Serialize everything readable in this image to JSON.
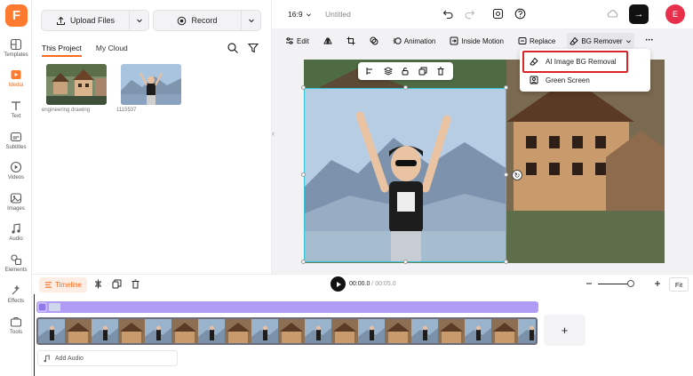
{
  "rail": {
    "items": [
      {
        "label": "Templates",
        "icon": "templates-icon"
      },
      {
        "label": "Media",
        "icon": "media-icon"
      },
      {
        "label": "Text",
        "icon": "text-icon"
      },
      {
        "label": "Subtitles",
        "icon": "subtitles-icon"
      },
      {
        "label": "Videos",
        "icon": "videos-icon"
      },
      {
        "label": "Images",
        "icon": "images-icon"
      },
      {
        "label": "Audio",
        "icon": "audio-icon"
      },
      {
        "label": "Elements",
        "icon": "elements-icon"
      },
      {
        "label": "Effects",
        "icon": "effects-icon"
      },
      {
        "label": "Tools",
        "icon": "tools-icon"
      }
    ],
    "active": "Media"
  },
  "panel": {
    "upload_label": "Upload Files",
    "record_label": "Record",
    "tabs": [
      "This Project",
      "My Cloud"
    ],
    "active_tab": "This Project",
    "media": [
      {
        "caption": "engineering drawing"
      },
      {
        "caption": "1115537"
      }
    ]
  },
  "topbar": {
    "ratio": "16:9",
    "title": "Untitled",
    "avatar_initial": "E",
    "export_arrow": "→"
  },
  "toolbar": {
    "edit": "Edit",
    "animation": "Animation",
    "inside_motion": "Inside Motion",
    "replace": "Replace",
    "bg_remover": "BG Remover",
    "more": "•••"
  },
  "dropdown": {
    "items": [
      "AI Image BG Removal",
      "Green Screen"
    ],
    "highlighted": "AI Image BG Removal"
  },
  "timeline": {
    "label": "Timeline",
    "current_time": "00:00.0",
    "separator": " / ",
    "total_time": "00:05.0",
    "fit": "Fit",
    "add_audio": "Add Audio",
    "add_clip": "+"
  },
  "colors": {
    "accent": "#ff6a1a",
    "selection": "#2fc4d6",
    "highlight_box": "#d9262b",
    "track_purple": "#b09cf5",
    "avatar_bg": "#e8304c"
  }
}
